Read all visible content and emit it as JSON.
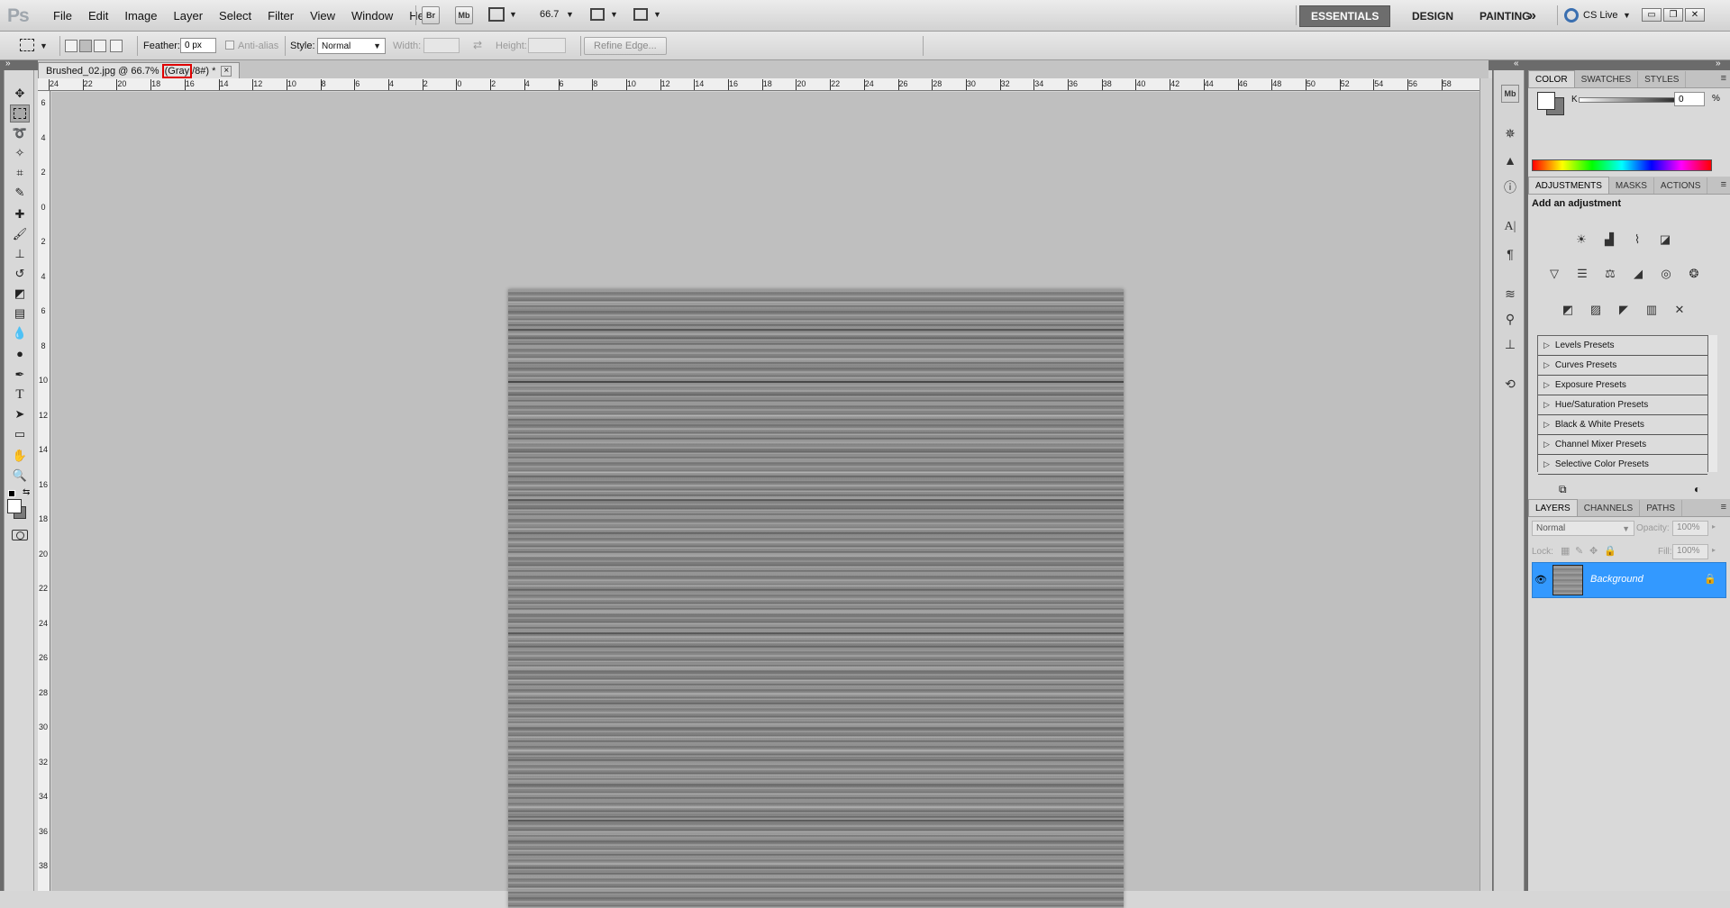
{
  "app": {
    "logo": "Ps"
  },
  "menu": [
    "File",
    "Edit",
    "Image",
    "Layer",
    "Select",
    "Filter",
    "View",
    "Window",
    "Help"
  ],
  "menubar_buttons": {
    "bridge": "Br",
    "mini_bridge": "Mb",
    "zoom": "66.7"
  },
  "workspaces": {
    "essentials": "ESSENTIALS",
    "design": "DESIGN",
    "painting": "PAINTING",
    "more": "»",
    "cs_live": "CS Live"
  },
  "window_controls": {
    "minimize": "▭",
    "restore": "❐",
    "close": "✕"
  },
  "options": {
    "feather_label": "Feather:",
    "feather_value": "0 px",
    "antialias_label": "Anti-alias",
    "style_label": "Style:",
    "style_value": "Normal",
    "width_label": "Width:",
    "height_label": "Height:",
    "refine_edge": "Refine Edge..."
  },
  "document": {
    "tab_prefix": "Brushed_02.jpg @ 66.7% ",
    "tab_highlight": "(Gray",
    "tab_suffix": "/8#) *",
    "close": "×"
  },
  "ruler_top": [
    "24",
    "22",
    "20",
    "18",
    "16",
    "14",
    "12",
    "10",
    "8",
    "6",
    "4",
    "2",
    "0",
    "2",
    "4",
    "6",
    "8",
    "10",
    "12",
    "14",
    "16",
    "18",
    "20",
    "22",
    "24",
    "26",
    "28",
    "30",
    "32",
    "34",
    "36",
    "38",
    "40",
    "42",
    "44",
    "46",
    "48",
    "50",
    "52",
    "54",
    "56",
    "58"
  ],
  "ruler_left": [
    "6",
    "4",
    "2",
    "0",
    "2",
    "4",
    "6",
    "8",
    "10",
    "12",
    "14",
    "16",
    "18",
    "20",
    "22",
    "24",
    "26",
    "28",
    "30",
    "32",
    "34",
    "36",
    "38"
  ],
  "panels": {
    "color": {
      "tabs": [
        "COLOR",
        "SWATCHES",
        "STYLES"
      ],
      "channel_label": "K",
      "channel_value": "0",
      "unit": "%"
    },
    "adjustments": {
      "tabs": [
        "ADJUSTMENTS",
        "MASKS",
        "ACTIONS"
      ],
      "heading": "Add an adjustment",
      "presets": [
        "Levels Presets",
        "Curves Presets",
        "Exposure Presets",
        "Hue/Saturation Presets",
        "Black & White Presets",
        "Channel Mixer Presets",
        "Selective Color Presets"
      ]
    },
    "layers": {
      "tabs": [
        "LAYERS",
        "CHANNELS",
        "PATHS"
      ],
      "blend_mode": "Normal",
      "opacity_label": "Opacity:",
      "opacity_value": "100%",
      "lock_label": "Lock:",
      "fill_label": "Fill:",
      "fill_value": "100%",
      "layer_name": "Background"
    }
  },
  "colors": {
    "accent": "#3399ff",
    "highlight": "#e00000",
    "canvas_bg": "#bfbfbf"
  }
}
